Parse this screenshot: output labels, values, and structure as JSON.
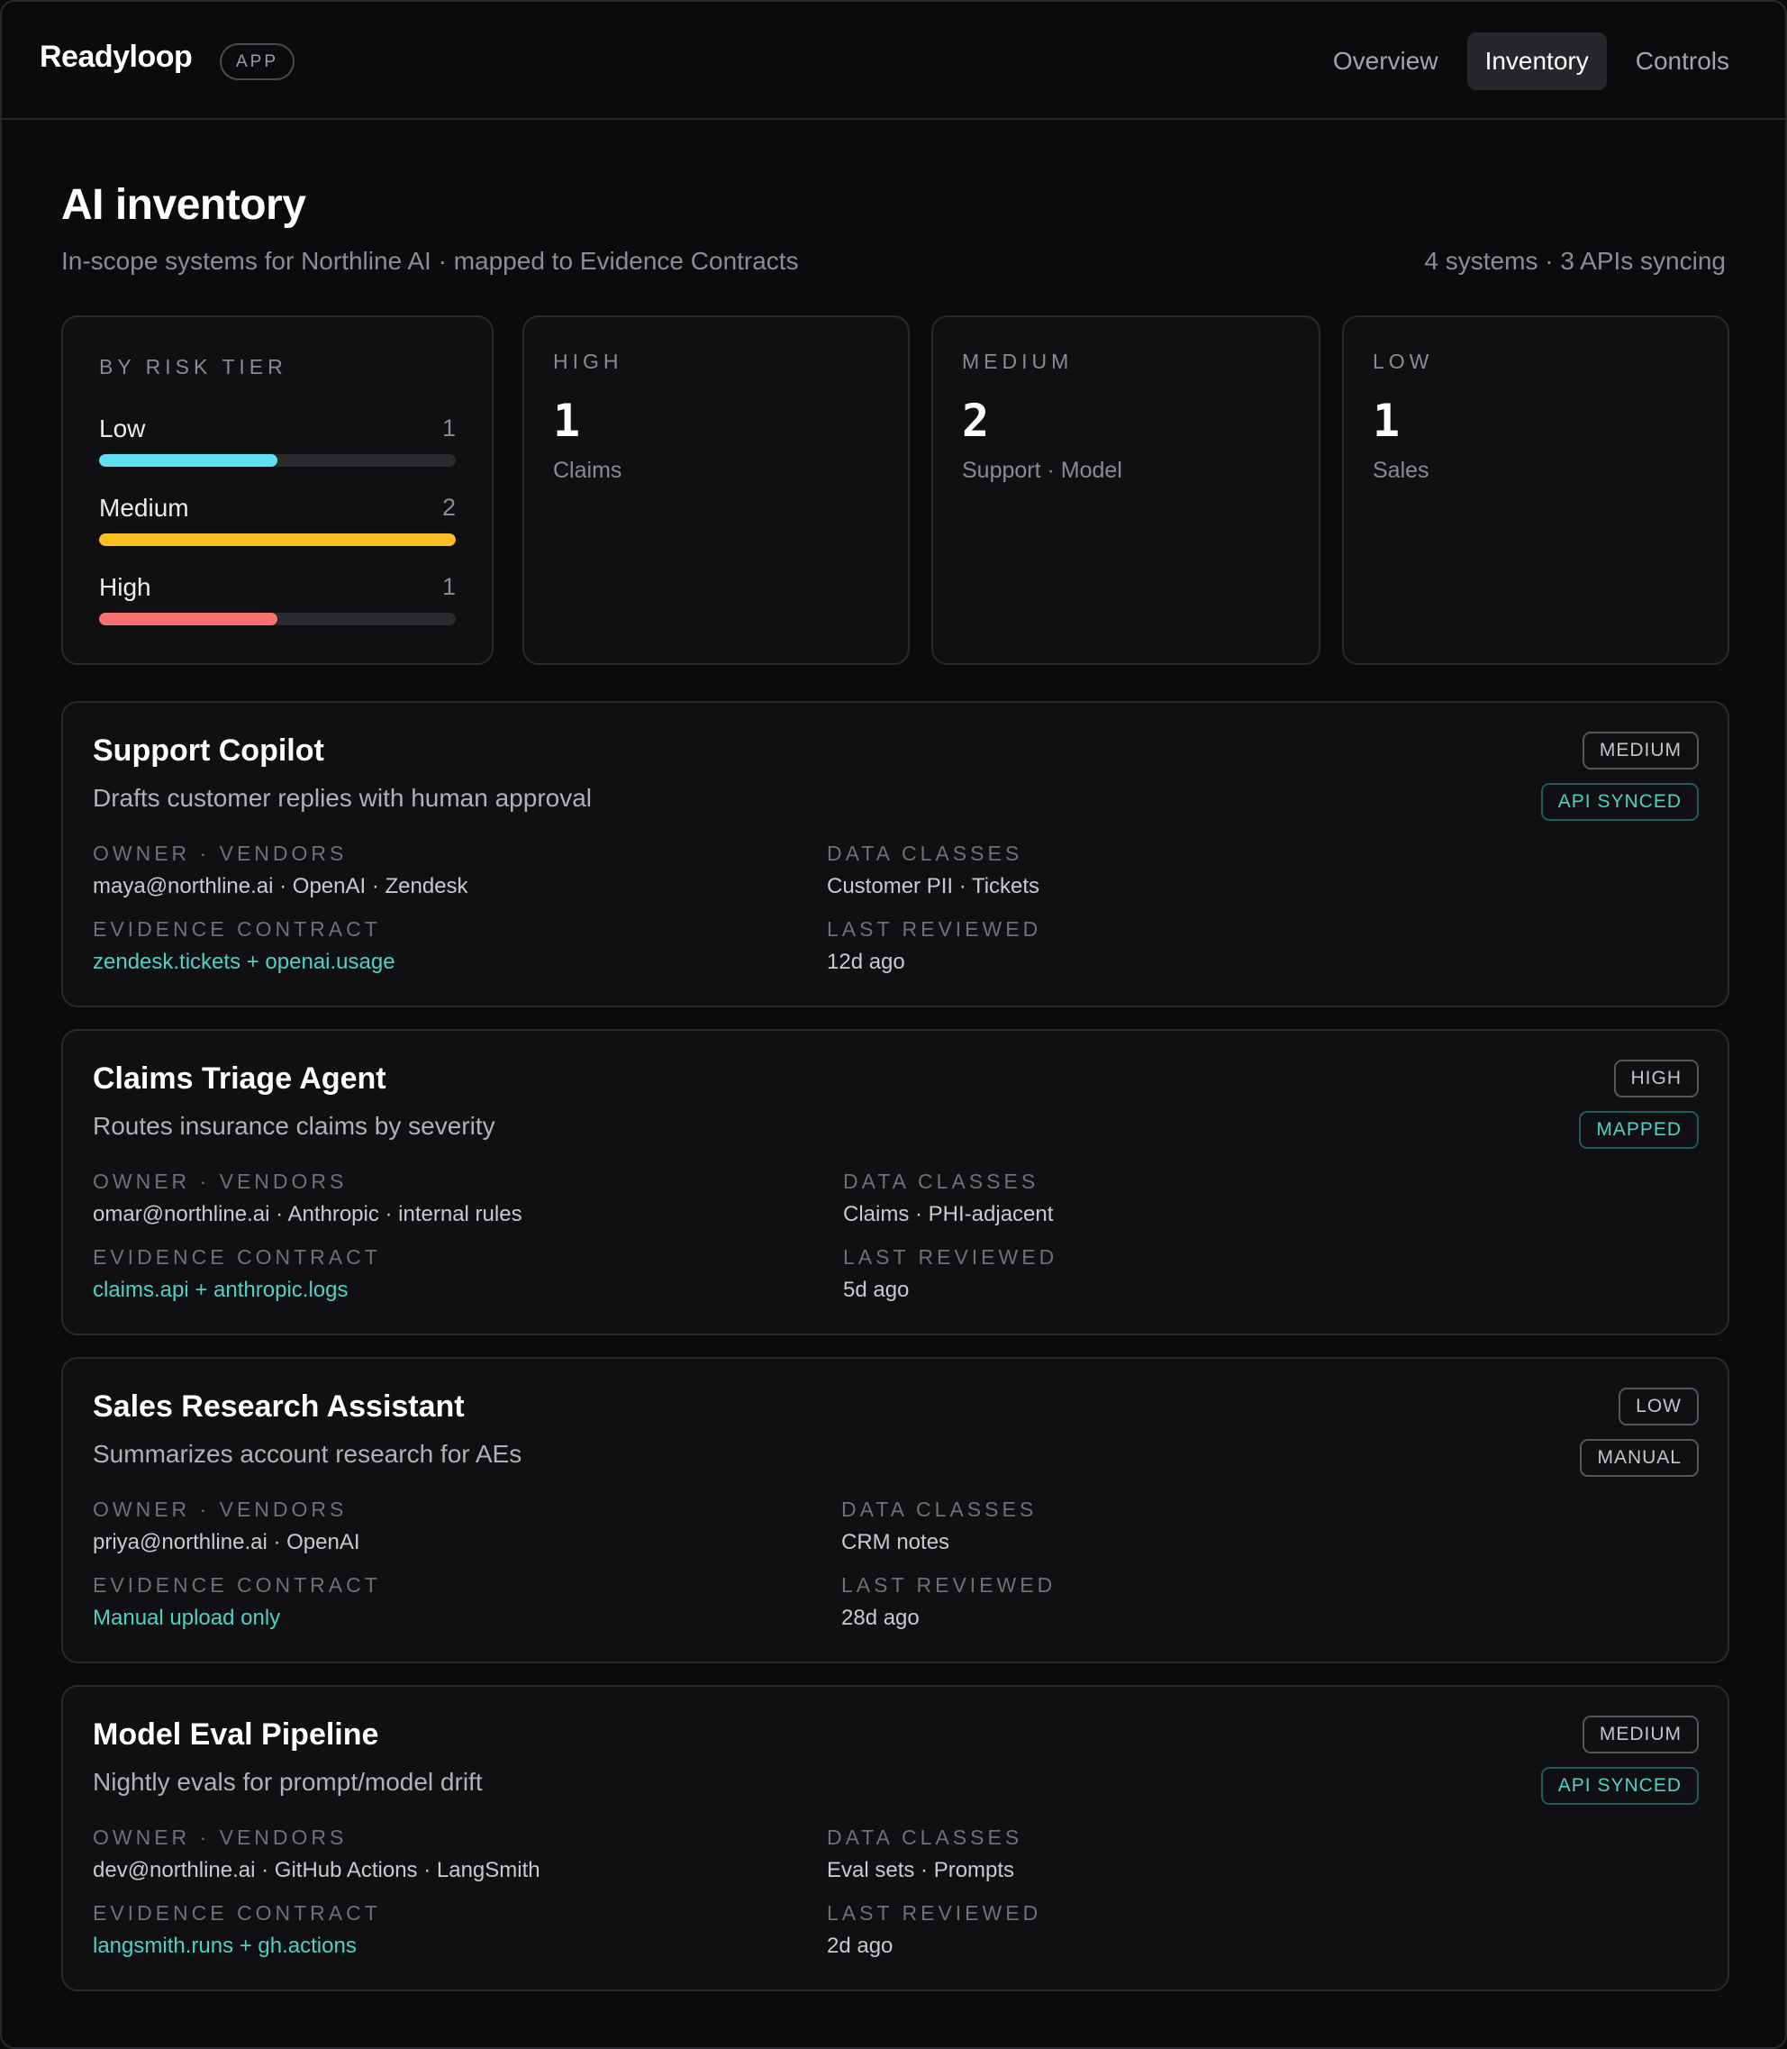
{
  "header": {
    "brand": "Readyloop",
    "badge": "APP",
    "nav": [
      "Overview",
      "Inventory",
      "Controls"
    ],
    "active_tab": "Inventory"
  },
  "page": {
    "title": "AI inventory",
    "subtitle": "In-scope systems for Northline AI · mapped to Evidence Contracts",
    "meta": "4 systems · 3 APIs syncing"
  },
  "risk_summary": {
    "title": "BY RISK TIER",
    "tiers": [
      {
        "label": "Low",
        "count": "1",
        "fraction": 0.5,
        "color": "#5ee0f0"
      },
      {
        "label": "Medium",
        "count": "2",
        "fraction": 1.0,
        "color": "#fbbf24"
      },
      {
        "label": "High",
        "count": "1",
        "fraction": 0.5,
        "color": "#f87171"
      }
    ]
  },
  "stat_cards": [
    {
      "label": "HIGH",
      "value": "1",
      "sub": "Claims"
    },
    {
      "label": "MEDIUM",
      "value": "2",
      "sub": "Support · Model"
    },
    {
      "label": "LOW",
      "value": "1",
      "sub": "Sales"
    }
  ],
  "field_labels": {
    "owner": "OWNER · VENDORS",
    "data_classes": "DATA CLASSES",
    "evidence": "EVIDENCE CONTRACT",
    "reviewed": "LAST REVIEWED"
  },
  "systems": [
    {
      "name": "Support Copilot",
      "description": "Drafts customer replies with human approval",
      "tier": "MEDIUM",
      "status": "API SYNCED",
      "status_style": "teal",
      "owner": "maya@northline.ai · OpenAI · Zendesk",
      "data_classes": "Customer PII · Tickets",
      "evidence": "zendesk.tickets + openai.usage",
      "reviewed": "12d ago"
    },
    {
      "name": "Claims Triage Agent",
      "description": "Routes insurance claims by severity",
      "tier": "HIGH",
      "status": "MAPPED",
      "status_style": "teal",
      "owner": "omar@northline.ai · Anthropic · internal rules",
      "data_classes": "Claims · PHI-adjacent",
      "evidence": "claims.api + anthropic.logs",
      "reviewed": "5d ago"
    },
    {
      "name": "Sales Research Assistant",
      "description": "Summarizes account research for AEs",
      "tier": "LOW",
      "status": "MANUAL",
      "status_style": "grey",
      "owner": "priya@northline.ai · OpenAI",
      "data_classes": "CRM notes",
      "evidence": "Manual upload only",
      "reviewed": "28d ago"
    },
    {
      "name": "Model Eval Pipeline",
      "description": "Nightly evals for prompt/model drift",
      "tier": "MEDIUM",
      "status": "API SYNCED",
      "status_style": "teal",
      "owner": "dev@northline.ai · GitHub Actions · LangSmith",
      "data_classes": "Eval sets · Prompts",
      "evidence": "langsmith.runs + gh.actions",
      "reviewed": "2d ago"
    }
  ]
}
